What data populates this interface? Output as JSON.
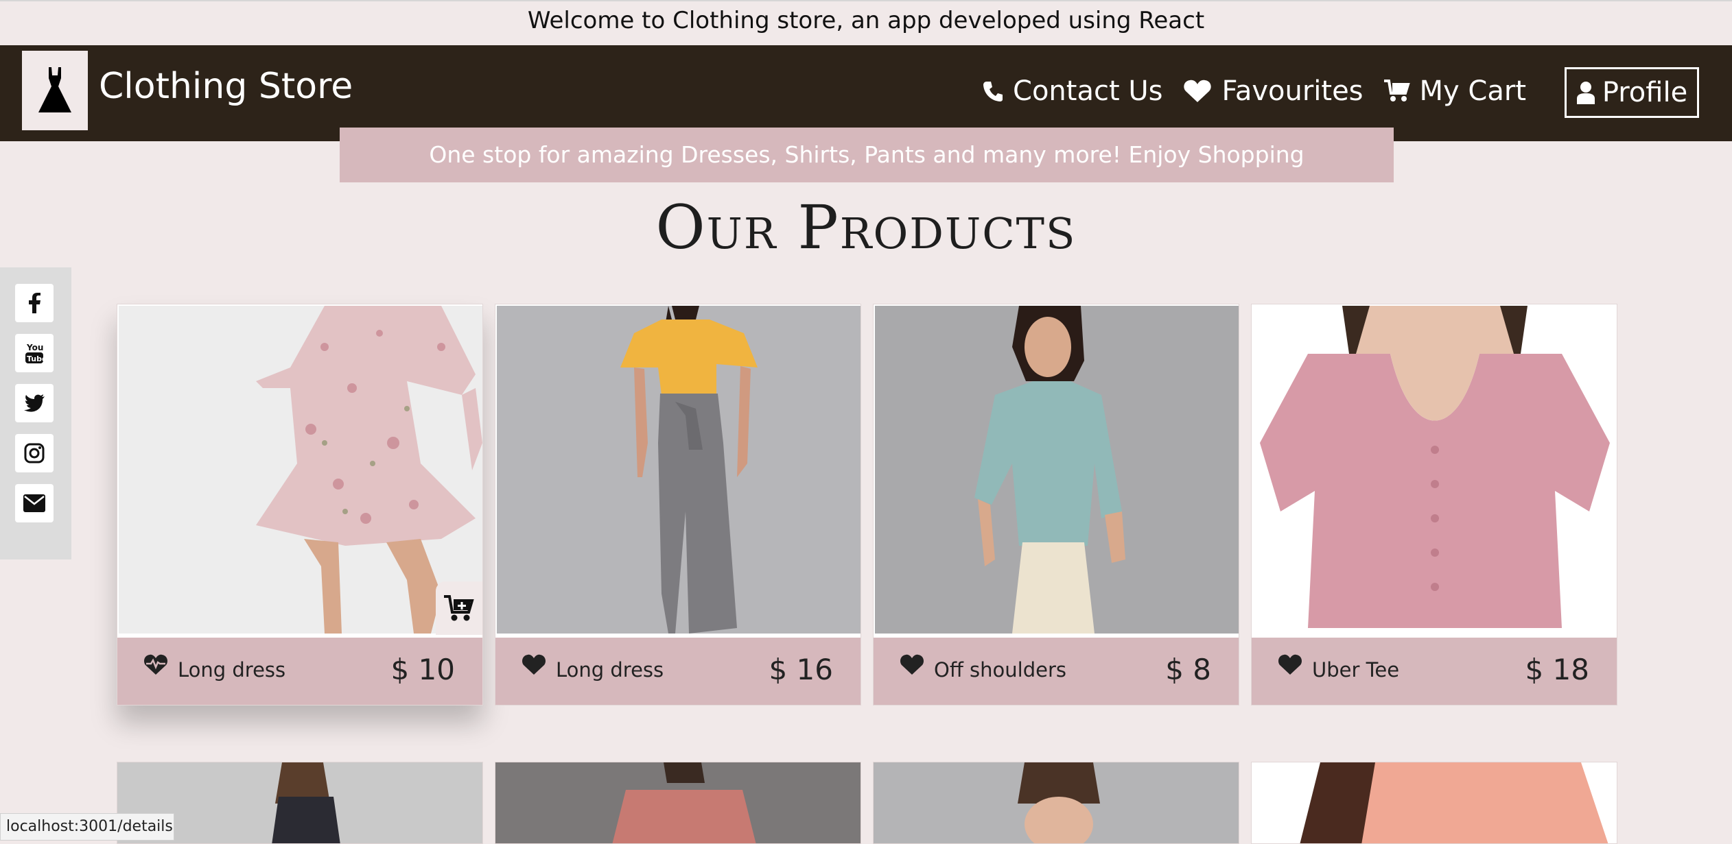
{
  "top_banner": "Welcome to Clothing store, an app developed using React",
  "navbar": {
    "brand": "Clothing Store",
    "links": [
      {
        "label": "Contact Us",
        "icon": "phone-icon"
      },
      {
        "label": "Favourites",
        "icon": "heart-icon"
      },
      {
        "label": "My Cart",
        "icon": "cart-icon"
      }
    ],
    "profile_label": "Profile"
  },
  "tagline": "One stop for amazing Dresses, Shirts, Pants and many more! Enjoy Shopping",
  "section_title": "Our Products",
  "social": [
    "facebook-icon",
    "youtube-icon",
    "twitter-icon",
    "instagram-icon",
    "envelope-icon"
  ],
  "products": [
    {
      "name": "Long dress",
      "price": "$ 10",
      "image": "pink floral dress"
    },
    {
      "name": "Long dress",
      "price": "$ 16",
      "image": "yellow top with grey trousers"
    },
    {
      "name": "Off shoulders",
      "price": "$ 8",
      "image": "teal blouse"
    },
    {
      "name": "Uber Tee",
      "price": "$ 18",
      "image": "pink button tee"
    }
  ],
  "status_url": "localhost:3001/details",
  "colors": {
    "navbar": "#2d2319",
    "accent": "#d6b8bc",
    "background": "#f1e9e9"
  }
}
